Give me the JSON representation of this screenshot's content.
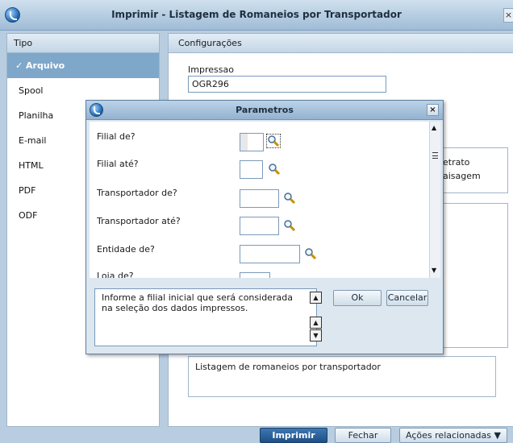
{
  "window": {
    "title": "Imprimir - Listagem de Romaneios por Transportador",
    "close": "×"
  },
  "left": {
    "header": "Tipo",
    "items": [
      {
        "label": "✓ Arquivo",
        "selected": true
      },
      {
        "label": "Spool"
      },
      {
        "label": "Planilha"
      },
      {
        "label": "E-mail"
      },
      {
        "label": "HTML"
      },
      {
        "label": "PDF"
      },
      {
        "label": "ODF"
      }
    ]
  },
  "right": {
    "header": "Configurações",
    "impressao_label": "Impressao",
    "impressao_value": "OGR296",
    "orientation": [
      "etrato",
      "aisagem"
    ],
    "description": "Listagem de romaneios por transportador"
  },
  "buttons": {
    "imprimir": "Imprimir",
    "fechar": "Fechar",
    "acoes": "Ações relacionadas ▼"
  },
  "dialog": {
    "title": "Parametros",
    "close": "×",
    "params": [
      "Filial de?",
      "Filial até?",
      "Transportador de?",
      "Transportador até?",
      "Entidade de?",
      "Loja de?"
    ],
    "help_text": "Informe a filial inicial que será considerada na seleção dos dados impressos.",
    "ok": "Ok",
    "cancel": "Cancelar"
  },
  "colors": {
    "accent": "#1d4f86",
    "selected_item": "#7ea7ca",
    "window_bg": "#b9cde0"
  },
  "icons": [
    "app-logo-icon",
    "close-icon",
    "checkmark-icon",
    "magnifier-icon",
    "scroll-up-icon",
    "scroll-down-icon"
  ]
}
